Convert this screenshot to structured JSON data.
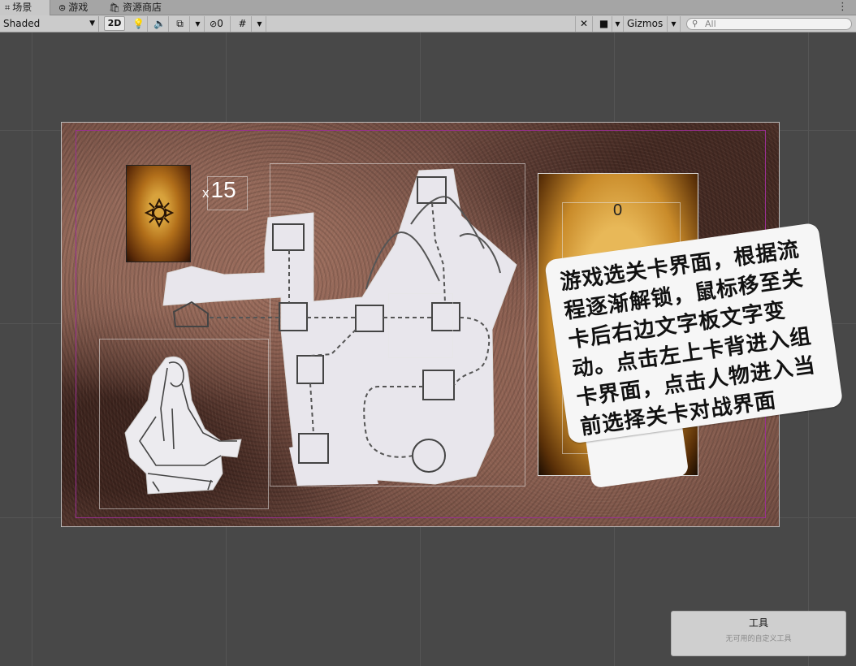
{
  "tabs": [
    {
      "label": "场景",
      "icon": "grid-icon"
    },
    {
      "label": "游戏",
      "icon": "gamepad-icon"
    },
    {
      "label": "资源商店",
      "icon": "shopping-bag-icon"
    }
  ],
  "toolbar": {
    "shading_mode": "Shaded",
    "mode_2d": "2D",
    "hidden_count": "0",
    "gizmos_label": "Gizmos",
    "search_placeholder": "All"
  },
  "scene": {
    "card_count_prefix": "x",
    "card_count": "15",
    "panel_value": "0",
    "note_text": "游戏选关卡界面，根据流程逐渐解锁，鼠标移至关卡后右边文字板文字变动。点击左上卡背进入组卡界面，点击人物进入当前选择关卡对战界面"
  },
  "tools_overlay": {
    "title": "工具",
    "subtitle": "无可用的自定义工具"
  },
  "colors": {
    "scene_bg": "#484848",
    "canvas_frame": "#9a2f93"
  }
}
